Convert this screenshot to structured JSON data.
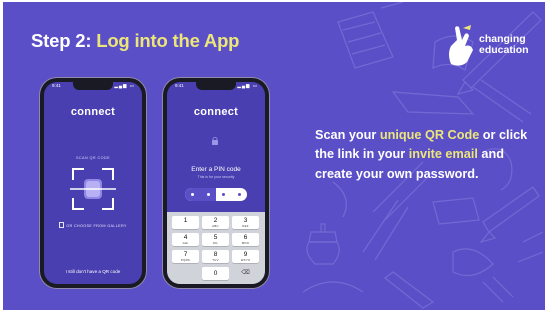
{
  "slide": {
    "step_number": "Step 2:",
    "step_title": "Log into the App",
    "brand": {
      "line1": "changing",
      "line2": "education",
      "icon": "hand-gesture-icon"
    }
  },
  "phone_qr": {
    "status_time": "9:41",
    "status_icons": "▂▄▆ ▭",
    "logo": "connect",
    "scan_label": "SCAN QR CODE",
    "gallery_label": "OR CHOOSE FROM GALLERY",
    "no_qr_link": "I still don't have a QR code"
  },
  "phone_pin": {
    "status_time": "9:41",
    "status_icons": "▂▄▆ ▭",
    "logo": "connect",
    "title": "Enter a PIN code",
    "subtitle": "This is for your security",
    "pin_entered": 2,
    "pin_length": 4,
    "keypad": [
      {
        "num": "1",
        "letters": ""
      },
      {
        "num": "2",
        "letters": "ABC"
      },
      {
        "num": "3",
        "letters": "DEF"
      },
      {
        "num": "4",
        "letters": "GHI"
      },
      {
        "num": "5",
        "letters": "JKL"
      },
      {
        "num": "6",
        "letters": "MNO"
      },
      {
        "num": "7",
        "letters": "PQRS"
      },
      {
        "num": "8",
        "letters": "TUV"
      },
      {
        "num": "9",
        "letters": "WXYZ"
      },
      {
        "num": "0",
        "letters": ""
      }
    ],
    "backspace": "⌫"
  },
  "instructions": {
    "p1": "Scan your ",
    "h1": "unique QR Code",
    "p2": " or click the link  in your ",
    "h2": "invite email",
    "p3": " and create your own password."
  },
  "colors": {
    "background": "#5b4fc8",
    "highlight": "#ece67a",
    "text": "#ffffff"
  }
}
